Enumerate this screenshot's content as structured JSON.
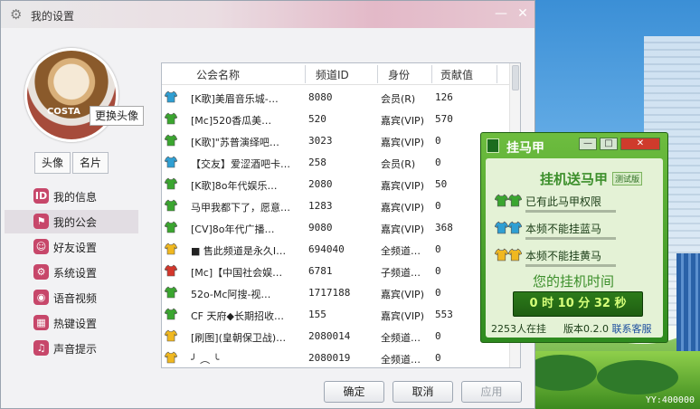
{
  "desktop": {
    "yy_id": "YY:400000"
  },
  "settings_window": {
    "title": "我的设置",
    "avatar": {
      "brand": "COSTA",
      "change_tip": "更换头像",
      "tabs": [
        {
          "label": "头像"
        },
        {
          "label": "名片"
        }
      ]
    },
    "nav": [
      {
        "label": "我的信息",
        "icon": "id-card-icon",
        "color": "#c7476a",
        "active": false
      },
      {
        "label": "我的公会",
        "icon": "flag-icon",
        "color": "#c7476a",
        "active": true
      },
      {
        "label": "好友设置",
        "icon": "friends-gear-icon",
        "color": "#c7476a",
        "active": false
      },
      {
        "label": "系统设置",
        "icon": "gear-icon",
        "color": "#c7476a",
        "active": false
      },
      {
        "label": "语音视频",
        "icon": "microphone-icon",
        "color": "#c7476a",
        "active": false
      },
      {
        "label": "热键设置",
        "icon": "keyboard-icon",
        "color": "#c7476a",
        "active": false
      },
      {
        "label": "声音提示",
        "icon": "music-note-icon",
        "color": "#c7476a",
        "active": false
      }
    ],
    "table": {
      "columns": [
        "公会名称",
        "频道ID",
        "身份",
        "贡献值"
      ],
      "rows": [
        {
          "shirt": "#2f9fd3",
          "name": "[K歌]美眉音乐城-…",
          "id": "8080",
          "role": "会员(R)",
          "contribution": "126"
        },
        {
          "shirt": "#3aa62f",
          "name": "[Mc]520香瓜美…",
          "id": "520",
          "role": "嘉宾(VIP)",
          "contribution": "570"
        },
        {
          "shirt": "#3aa62f",
          "name": "[K歌]\"苏普演绎吧…",
          "id": "3023",
          "role": "嘉宾(VIP)",
          "contribution": "0"
        },
        {
          "shirt": "#2f9fd3",
          "name": "【交友】爱涩酒吧卡…",
          "id": "258",
          "role": "会员(R)",
          "contribution": "0"
        },
        {
          "shirt": "#3aa62f",
          "name": "[K歌]8o年代娱乐…",
          "id": "2080",
          "role": "嘉宾(VIP)",
          "contribution": "50"
        },
        {
          "shirt": "#3aa62f",
          "name": "马甲我都下了，愿意…",
          "id": "1283",
          "role": "嘉宾(VIP)",
          "contribution": "0"
        },
        {
          "shirt": "#3aa62f",
          "name": "[CV]8o年代广播…",
          "id": "9080",
          "role": "嘉宾(VIP)",
          "contribution": "368"
        },
        {
          "shirt": "#f0b820",
          "name": "■ 售此频道是永久I…",
          "id": "694040",
          "role": "全频道…",
          "contribution": "0"
        },
        {
          "shirt": "#d4362b",
          "name": "[Mc]【中国社会娱…",
          "id": "6781",
          "role": "子频道…",
          "contribution": "0"
        },
        {
          "shirt": "#3aa62f",
          "name": "52o-Mc阿搜-视…",
          "id": "1717188",
          "role": "嘉宾(VIP)",
          "contribution": "0"
        },
        {
          "shirt": "#3aa62f",
          "name": "CF 天府◆长期招收…",
          "id": "155",
          "role": "嘉宾(VIP)",
          "contribution": "553"
        },
        {
          "shirt": "#f0b820",
          "name": "[刷图](皇朝保卫战)…",
          "id": "2080014",
          "role": "全频道…",
          "contribution": "0"
        },
        {
          "shirt": "#f0b820",
          "name": "╯ ︵ ╰",
          "id": "2080019",
          "role": "全频道…",
          "contribution": "0"
        }
      ]
    },
    "buttons": {
      "ok": "确定",
      "cancel": "取消",
      "apply": "应用"
    }
  },
  "horse_window": {
    "title": "挂马甲",
    "heading": "挂机送马甲",
    "badge": "测试版",
    "status": [
      {
        "text": "已有此马甲权限",
        "colors": [
          "#3aa62f",
          "#3aa62f"
        ]
      },
      {
        "text": "本频不能挂蓝马",
        "colors": [
          "#2f9fd3",
          "#2f9fd3"
        ]
      },
      {
        "text": "本频不能挂黄马",
        "colors": [
          "#f0b820",
          "#f0b820"
        ]
      }
    ],
    "online_heading": "您的挂机时间",
    "timer": {
      "hours": "0",
      "hours_unit": "时",
      "minutes": "10",
      "minutes_unit": "分",
      "seconds": "32",
      "seconds_unit": "秒"
    },
    "online_count": "2253人在挂",
    "version": "版本0.2.0",
    "contact": "联系客服"
  }
}
